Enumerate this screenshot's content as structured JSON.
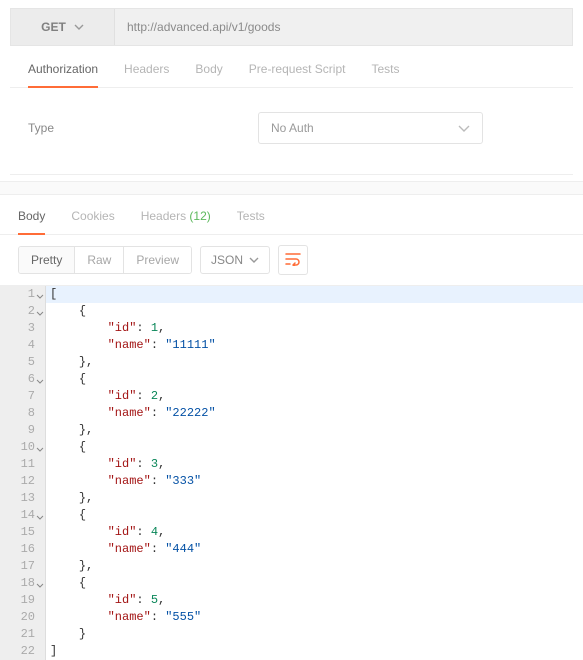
{
  "request": {
    "method": "GET",
    "url": "http://advanced.api/v1/goods",
    "tabs": [
      "Authorization",
      "Headers",
      "Body",
      "Pre-request Script",
      "Tests"
    ],
    "active_tab": "Authorization",
    "auth": {
      "type_label": "Type",
      "selected": "No Auth"
    }
  },
  "response": {
    "tabs": {
      "body": "Body",
      "cookies": "Cookies",
      "headers_label": "Headers",
      "headers_count": "(12)",
      "tests": "Tests"
    },
    "active_tab": "Body",
    "view_modes": {
      "pretty": "Pretty",
      "raw": "Raw",
      "preview": "Preview"
    },
    "active_view": "Pretty",
    "format": "JSON",
    "body_data": [
      {
        "id": 1,
        "name": "11111"
      },
      {
        "id": 2,
        "name": "22222"
      },
      {
        "id": 3,
        "name": "333"
      },
      {
        "id": 4,
        "name": "444"
      },
      {
        "id": 5,
        "name": "555"
      }
    ]
  },
  "chart_data": {
    "type": "table",
    "title": "Response body of GET http://advanced.api/v1/goods",
    "columns": [
      "id",
      "name"
    ],
    "rows": [
      [
        1,
        "11111"
      ],
      [
        2,
        "22222"
      ],
      [
        3,
        "333"
      ],
      [
        4,
        "444"
      ],
      [
        5,
        "555"
      ]
    ]
  },
  "colors": {
    "accent": "#ff6c37",
    "count": "#5cb85c"
  }
}
